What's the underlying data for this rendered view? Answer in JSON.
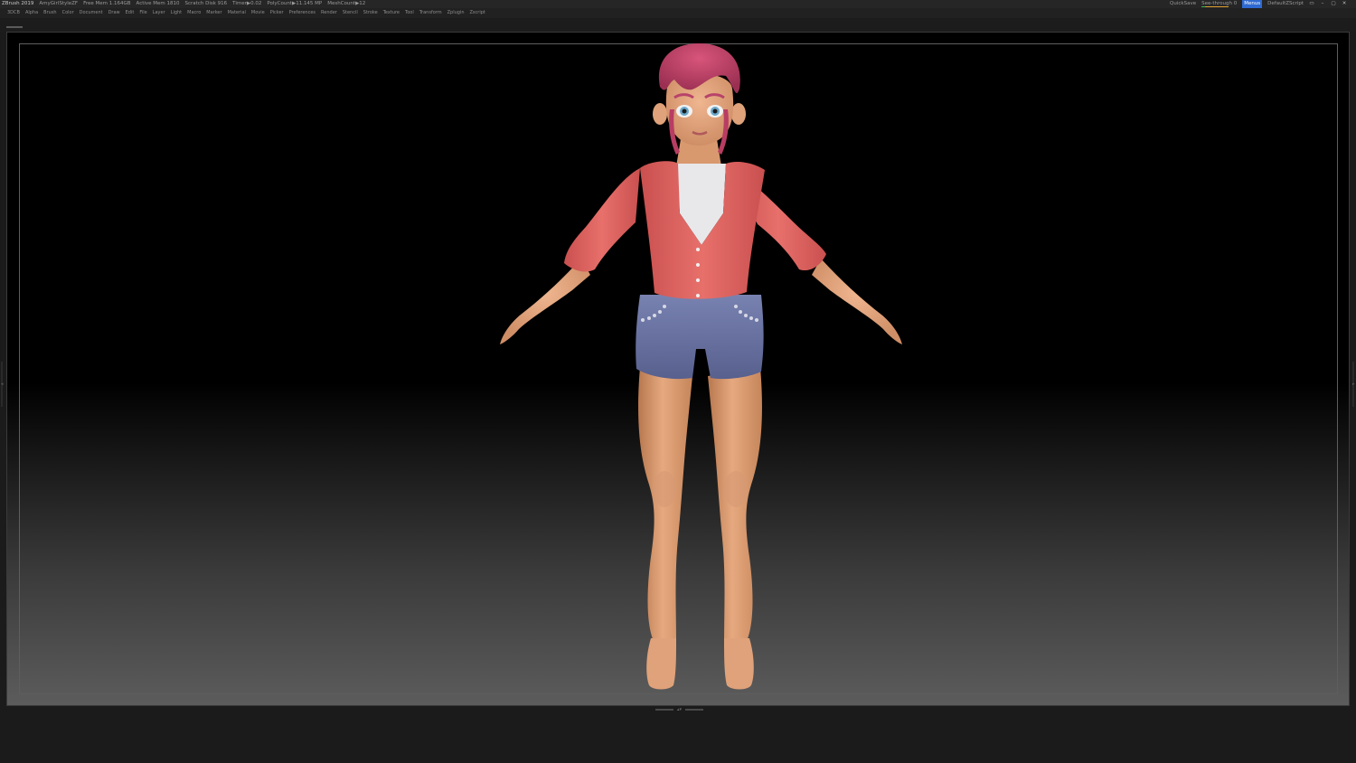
{
  "titlebar": {
    "app": "ZBrush 2019",
    "document": "AmyGirlStyleZF",
    "stats": [
      "Free Mem 1.164GB",
      "Active Mem 1810",
      "Scratch Disk 916",
      "Timer▶0.02",
      "PolyCount▶11.145 MP",
      "MeshCount▶12"
    ],
    "quicksave": "QuickSave",
    "seethrough": "See-through  0",
    "menus_button": "Menus",
    "script": "DefaultZScript",
    "window_controls": [
      "▭",
      "–",
      "▢",
      "✕"
    ]
  },
  "menubar": {
    "items": [
      "3DCB",
      "Alpha",
      "Brush",
      "Color",
      "Document",
      "Draw",
      "Edit",
      "File",
      "Layer",
      "Light",
      "Macro",
      "Marker",
      "Material",
      "Movie",
      "Picker",
      "Preferences",
      "Render",
      "Stencil",
      "Stroke",
      "Texture",
      "Tool",
      "Transform",
      "Zplugin",
      "Zscript"
    ]
  },
  "colors": {
    "hair": "#c8456a",
    "skin": "#e0a27a",
    "jacket": "#e0605e",
    "shirt": "#e8e8ea",
    "shorts": "#6c76a6",
    "accent": "#2e6ad1"
  },
  "icons": {
    "app_logo": "zbrush-logo-icon",
    "side_grip": "collapse-arrow-icon",
    "bottom_grip": "expand-up-icon"
  }
}
